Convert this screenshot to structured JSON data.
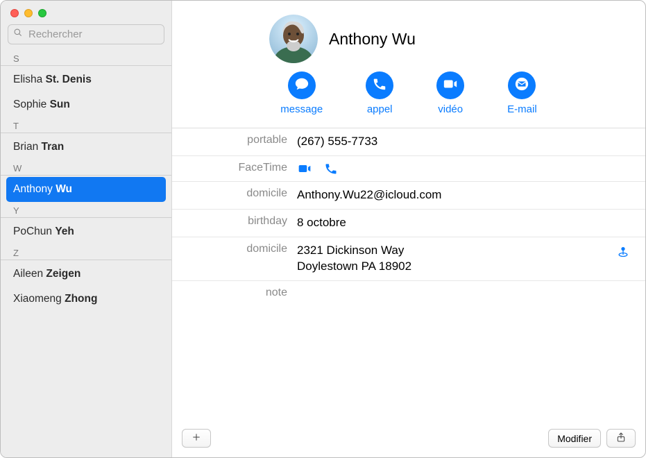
{
  "search": {
    "placeholder": "Rechercher"
  },
  "colors": {
    "accent": "#0a7cff",
    "selection": "#1178f2"
  },
  "sections": [
    {
      "letter": "S",
      "contacts": [
        {
          "first": "Elisha",
          "last": "St. Denis"
        },
        {
          "first": "Sophie",
          "last": "Sun"
        }
      ]
    },
    {
      "letter": "T",
      "contacts": [
        {
          "first": "Brian",
          "last": "Tran"
        }
      ]
    },
    {
      "letter": "W",
      "contacts": [
        {
          "first": "Anthony",
          "last": "Wu",
          "selected": true
        }
      ]
    },
    {
      "letter": "Y",
      "contacts": [
        {
          "first": "PoChun",
          "last": "Yeh"
        }
      ]
    },
    {
      "letter": "Z",
      "contacts": [
        {
          "first": "Aileen",
          "last": "Zeigen"
        },
        {
          "first": "Xiaomeng",
          "last": "Zhong"
        }
      ]
    }
  ],
  "card": {
    "name": "Anthony Wu",
    "actions": {
      "message": "message",
      "call": "appel",
      "video": "vidéo",
      "email": "E-mail"
    },
    "rows": {
      "portable_label": "portable",
      "portable_value": "(267) 555-7733",
      "facetime_label": "FaceTime",
      "domicile_email_label": "domicile",
      "domicile_email_value": "Anthony.Wu22@icloud.com",
      "birthday_label": "birthday",
      "birthday_value": "8 octobre",
      "domicile_addr_label": "domicile",
      "domicile_addr_line1": "2321 Dickinson Way",
      "domicile_addr_line2": "Doylestown PA 18902",
      "note_label": "note"
    }
  },
  "footer": {
    "edit": "Modifier"
  }
}
